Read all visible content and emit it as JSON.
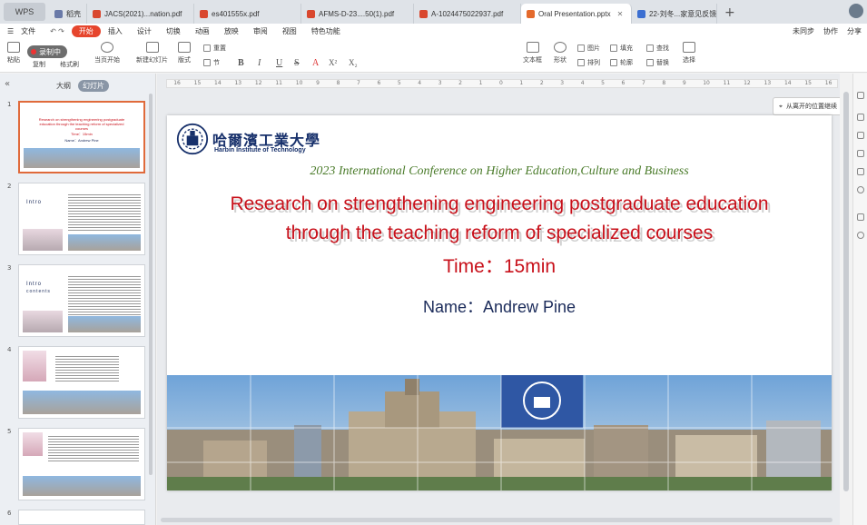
{
  "app_logo": "WPS",
  "tabs": [
    {
      "label": "稻壳",
      "color": "#6a7aa8"
    },
    {
      "label": "JACS(2021)...nation.pdf",
      "color": "#d9472e"
    },
    {
      "label": "es401555x.pdf",
      "color": "#d9472e"
    },
    {
      "label": "AFMS-D-23....50(1).pdf",
      "color": "#d9472e"
    },
    {
      "label": "A-1024475022937.pdf",
      "color": "#d9472e"
    },
    {
      "label": "Oral Presentation.pptx",
      "color": "#e46a2c",
      "active": true
    },
    {
      "label": "22-刘冬...家意见反馈",
      "color": "#3c6fd1"
    }
  ],
  "menu": {
    "file": "文件",
    "items": [
      "开始",
      "插入",
      "设计",
      "切换",
      "动画",
      "放映",
      "审阅",
      "视图",
      "特色功能"
    ],
    "right": [
      "未同步",
      "协作",
      "分享"
    ]
  },
  "ribbon": {
    "record_label": "录制中",
    "paste": "粘贴",
    "copy": "复制",
    "format_painter": "格式刷",
    "play_from_current": "当页开始",
    "new_slide": "新建幻灯片",
    "layout": "版式",
    "reset": "重置",
    "section": "节",
    "text_box": "文本框",
    "shape": "形状",
    "picture": "图片",
    "arrange": "排列",
    "fill": "填充",
    "outline": "轮廓",
    "find": "查找",
    "replace": "替换",
    "select": "选择",
    "bold": "B",
    "italic": "I",
    "underline": "U",
    "strike": "S",
    "font_color": "A",
    "superscript": "X²",
    "subscript": "X₂"
  },
  "panel": {
    "outline_tab": "大纲",
    "slides_tab": "幻灯片",
    "slide_numbers": [
      "1",
      "2",
      "3",
      "4",
      "5",
      "6"
    ],
    "thumb_title": "Research on strengthening engineering postgraduate education through the teaching reform of specialized courses",
    "thumb_time": "Time：15min",
    "thumb_name": "Name：Andrew Pine",
    "intro_text": "Intro",
    "contents_text": "contents"
  },
  "ruler_labels": [
    "16",
    "15",
    "14",
    "13",
    "12",
    "11",
    "10",
    "9",
    "8",
    "7",
    "6",
    "5",
    "4",
    "3",
    "2",
    "1",
    "0",
    "1",
    "2",
    "3",
    "4",
    "5",
    "6",
    "7",
    "8",
    "9",
    "10",
    "11",
    "12",
    "13",
    "14",
    "15",
    "16"
  ],
  "resume_tooltip": "从离开的位置继续",
  "slide": {
    "logo_cn": "哈爾濱工業大學",
    "logo_en": "Harbin Institute of Technology",
    "conference": "2023 International Conference on Higher Education,Culture and Business",
    "title_line1": "Research on strengthening engineering postgraduate education",
    "title_line2": "through the teaching reform of specialized courses",
    "time": "Time：15min",
    "name": "Name：Andrew Pine"
  },
  "colors": {
    "accent": "#e6452d",
    "title_red": "#c8101a",
    "conference_green": "#4a7b2a",
    "navy": "#1b2b5a"
  }
}
